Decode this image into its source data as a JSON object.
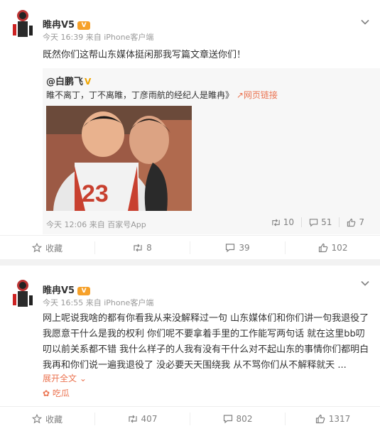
{
  "post1": {
    "username": "睢冉V5",
    "badge": "V",
    "meta": "今天 16:39 来自 iPhone客户端",
    "text": "既然你们这帮山东媒体挺闲那我写篇文章送你们！",
    "repost": {
      "username": "@白鹏飞",
      "verified_mark": "V",
      "text": "睢不离丁，丁不离睢，丁彦雨航的经纪人是睢冉》",
      "link_label": "网页链接",
      "jersey_text": "23",
      "meta": "今天 12:06 来自 百家号App",
      "stats": {
        "reposts": "10",
        "comments": "51",
        "likes": "7"
      }
    },
    "actions": {
      "favorite": "收藏",
      "reposts": "8",
      "comments": "39",
      "likes": "102"
    }
  },
  "post2": {
    "username": "睢冉V5",
    "badge": "V",
    "meta": "今天 16:55 来自 iPhone客户端",
    "text": "网上呢说我啥的都有你看我从来没解释过一句 山东媒体们和你们讲一句我退役了我愿意干什么是我的权利 你们呢不要拿着手里的工作能写两句话 就在这里bb叨叨以前关系都不错 我什么样子的人我有没有干什么对不起山东的事情你们都明白 我再和你们说一遍我退役了 没必要天天围绕我 从不骂你们从不解释就天 ...",
    "expand_label": "展开全文",
    "topic_label": "吃瓜",
    "actions": {
      "favorite": "收藏",
      "reposts": "407",
      "comments": "802",
      "likes": "1317"
    }
  },
  "colors": {
    "link": "#eb7350",
    "badge": "#f6a12a",
    "muted": "#999999"
  },
  "icons": [
    "avatar",
    "v-badge-icon",
    "chevron-down-icon",
    "link-icon",
    "repost-icon",
    "comment-icon",
    "like-icon",
    "star-icon",
    "watermelon-icon"
  ]
}
